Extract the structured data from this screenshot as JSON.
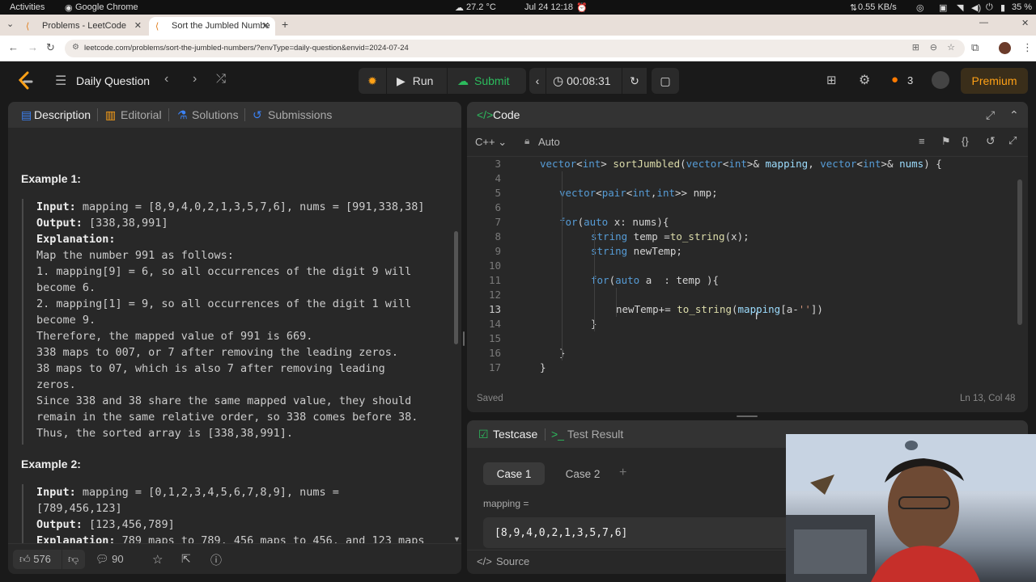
{
  "os": {
    "activities": "Activities",
    "app": "Google Chrome",
    "temp": "27.2 °C",
    "datetime": "Jul 24  12:18",
    "net": "0.55 KB/s",
    "battery": "35 %"
  },
  "browser": {
    "tabs": [
      {
        "label": "Problems - LeetCode"
      },
      {
        "label": "Sort the Jumbled Numbe"
      }
    ],
    "new_tab": "+",
    "url": "leetcode.com/problems/sort-the-jumbled-numbers/?envType=daily-question&envid=2024-07-24"
  },
  "header": {
    "daily": "Daily Question",
    "run": "Run",
    "submit": "Submit",
    "timer": "00:08:31",
    "streak": "3",
    "premium": "Premium"
  },
  "left": {
    "tabs": [
      "Description",
      "Editorial",
      "Solutions",
      "Submissions"
    ],
    "ex1": {
      "title": "Example 1:",
      "input_label": "Input:",
      "input": " mapping = [8,9,4,0,2,1,3,5,7,6], nums = [991,338,38]",
      "output_label": "Output:",
      "output": " [338,38,991]",
      "expl_label": "Explanation:",
      "lines": [
        "Map the number 991 as follows:",
        "1. mapping[9] = 6, so all occurrences of the digit 9 will",
        "become 6.",
        "2. mapping[1] = 9, so all occurrences of the digit 1 will",
        "become 9.",
        "Therefore, the mapped value of 991 is 669.",
        "338 maps to 007, or 7 after removing the leading zeros.",
        "38 maps to 07, which is also 7 after removing leading",
        "zeros.",
        "Since 338 and 38 share the same mapped value, they should",
        "remain in the same relative order, so 338 comes before 38.",
        "Thus, the sorted array is [338,38,991]."
      ]
    },
    "ex2": {
      "title": "Example 2:",
      "input_label": "Input:",
      "input": " mapping = [0,1,2,3,4,5,6,7,8,9], nums =",
      "input2": "[789,456,123]",
      "output_label": "Output:",
      "output": " [123,456,789]",
      "expl_label": "Explanation:",
      "expl": " 789 maps to 789, 456 maps to 456, and 123 maps"
    },
    "likes": "576",
    "comments": "90"
  },
  "code": {
    "title": "Code",
    "lang": "C++",
    "mode": "Auto",
    "status": "Saved",
    "cursor": "Ln 13, Col 48",
    "line_numbers": [
      "3",
      "4",
      "5",
      "6",
      "7",
      "8",
      "9",
      "10",
      "11",
      "12",
      "13",
      "14",
      "15",
      "16",
      "17"
    ]
  },
  "test": {
    "tab1": "Testcase",
    "tab2": "Test Result",
    "case1": "Case 1",
    "case2": "Case 2",
    "plus": "+",
    "var_label": "mapping =",
    "var_value": "[8,9,4,0,2,1,3,5,7,6]",
    "source": "Source"
  },
  "colors": {
    "accent_green": "#2cbb5d",
    "accent_blue": "#3b82f6",
    "premium": "#ffa116"
  }
}
